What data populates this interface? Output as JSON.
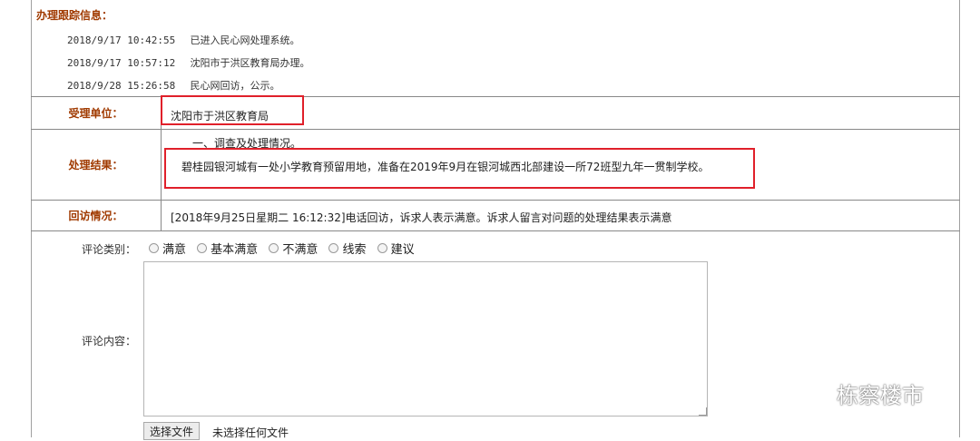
{
  "tracking": {
    "heading": "办理跟踪信息：",
    "entries": [
      {
        "time": "2018/9/17 10:42:55",
        "text": "已进入民心网处理系统。"
      },
      {
        "time": "2018/9/17 10:57:12",
        "text": "沈阳市于洪区教育局办理。"
      },
      {
        "time": "2018/9/28 15:26:58",
        "text": "民心网回访，公示。"
      }
    ]
  },
  "details": {
    "unit_label": "受理单位：",
    "unit_value": "沈阳市于洪区教育局",
    "result_label": "处理结果：",
    "result_line1": "一、调查及处理情况。",
    "result_line2": "碧桂园银河城有一处小学教育预留用地，准备在2019年9月在银河城西北部建设一所72班型九年一贯制学校。",
    "followup_label": "回访情况：",
    "followup_value": "[2018年9月25日星期二 16:12:32]电话回访，诉求人表示满意。诉求人留言对问题的处理结果表示满意"
  },
  "comment": {
    "category_label": "评论类别：",
    "options": [
      "满意",
      "基本满意",
      "不满意",
      "线索",
      "建议"
    ],
    "content_label": "评论内容：",
    "content_value": "",
    "file_button": "选择文件",
    "file_status": "未选择任何文件"
  },
  "watermark": {
    "text": "栋察楼市",
    "icon": "wechat-icon"
  },
  "colors": {
    "label": "#a03a00",
    "highlight": "#e0202a"
  }
}
